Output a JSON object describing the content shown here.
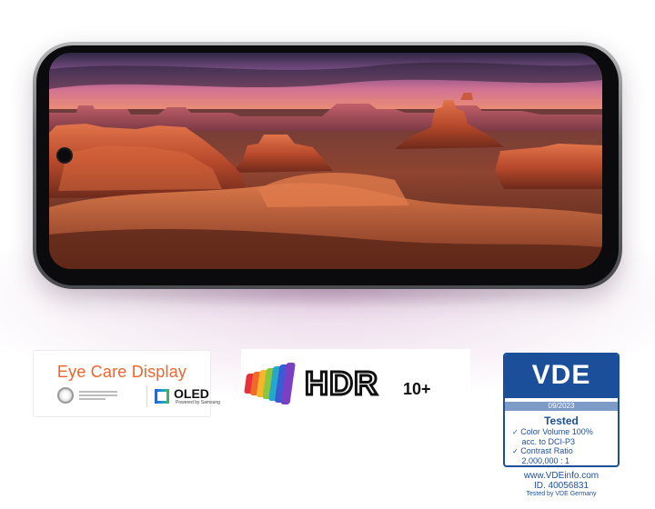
{
  "product_image": {
    "device": "smartphone",
    "scene": "desert mesa landscape at dusk"
  },
  "badges": {
    "eye_care": {
      "title": "Eye Care Display",
      "oled_label": "OLED",
      "oled_powered_by": "Powered by Samsung",
      "title_color": "#f0642c"
    },
    "hdr": {
      "logo_text": "HDR",
      "logo_suffix": "10+"
    },
    "vde": {
      "logo": "VDE",
      "date": "09/2023",
      "tested": "Tested",
      "items": [
        "Color Volume 100%",
        "acc. to DCI-P3",
        "Contrast Ratio",
        "2,000,000 : 1"
      ],
      "website": "www.VDEinfo.com",
      "id": "ID. 40056831",
      "footer": "Tested by VDE Germany",
      "brand_color": "#1c4f9a"
    }
  }
}
